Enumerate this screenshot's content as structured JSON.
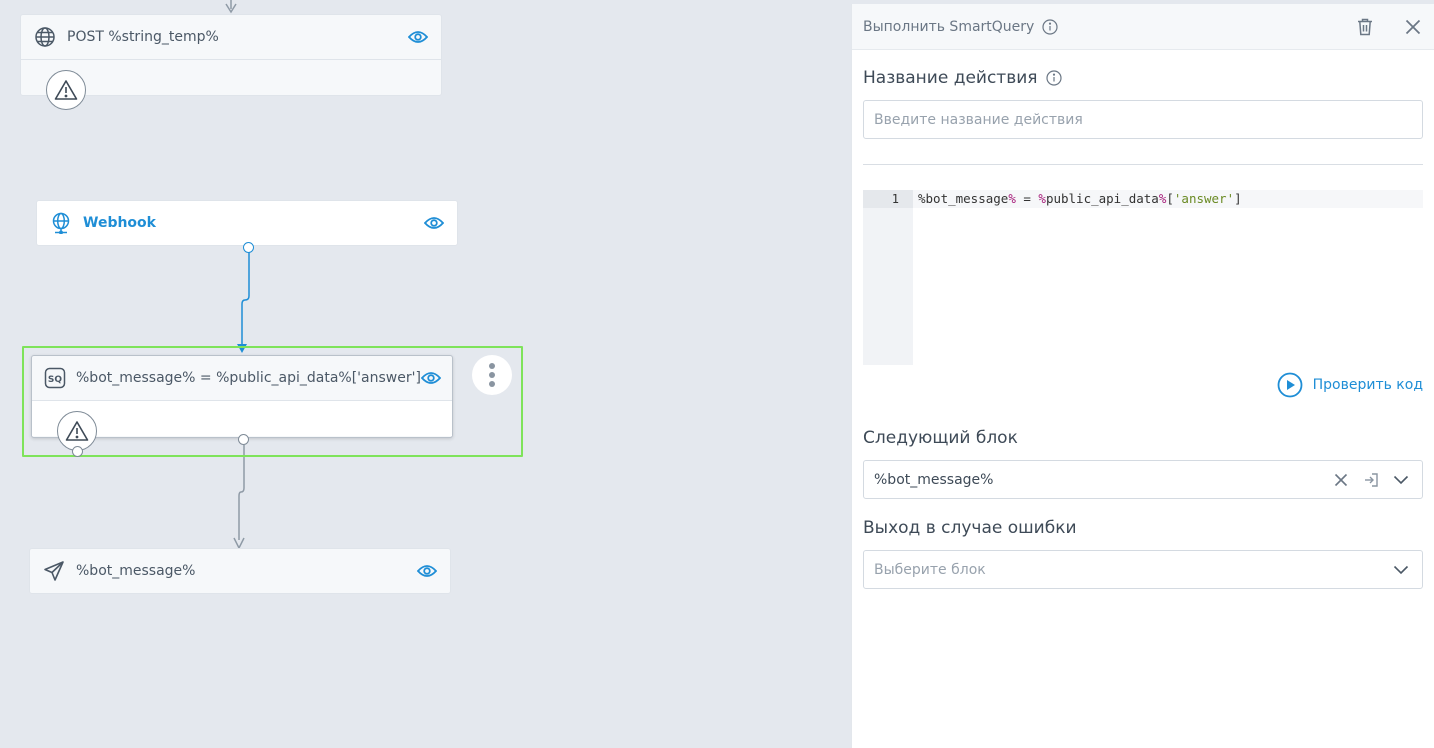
{
  "canvas": {
    "nodes": {
      "post": {
        "title": "POST %string_temp%"
      },
      "webhook": {
        "title": "Webhook"
      },
      "smartquery": {
        "title": "%bot_message% = %public_api_data%['answer']"
      },
      "message": {
        "title": "%bot_message%"
      }
    }
  },
  "panel": {
    "title": "Выполнить SmartQuery",
    "action_name": {
      "label": "Название действия",
      "placeholder": "Введите название действия"
    },
    "editor": {
      "line_number": "1",
      "code": {
        "lhs": "%bot_message",
        "op1": "%",
        "eq": " = ",
        "op2": "%",
        "rhs": "public_api_data",
        "op3": "%",
        "open": "[",
        "str": "'answer'",
        "close": "]"
      }
    },
    "check_code": "Проверить код",
    "next_block": {
      "label": "Следующий блок",
      "value": "%bot_message%"
    },
    "error_exit": {
      "label": "Выход в случае ошибки",
      "placeholder": "Выберите блок"
    }
  },
  "colors": {
    "accent_blue": "#1f8ed6",
    "selection_green": "#7ee35a",
    "canvas_bg": "#e4e8ee"
  }
}
